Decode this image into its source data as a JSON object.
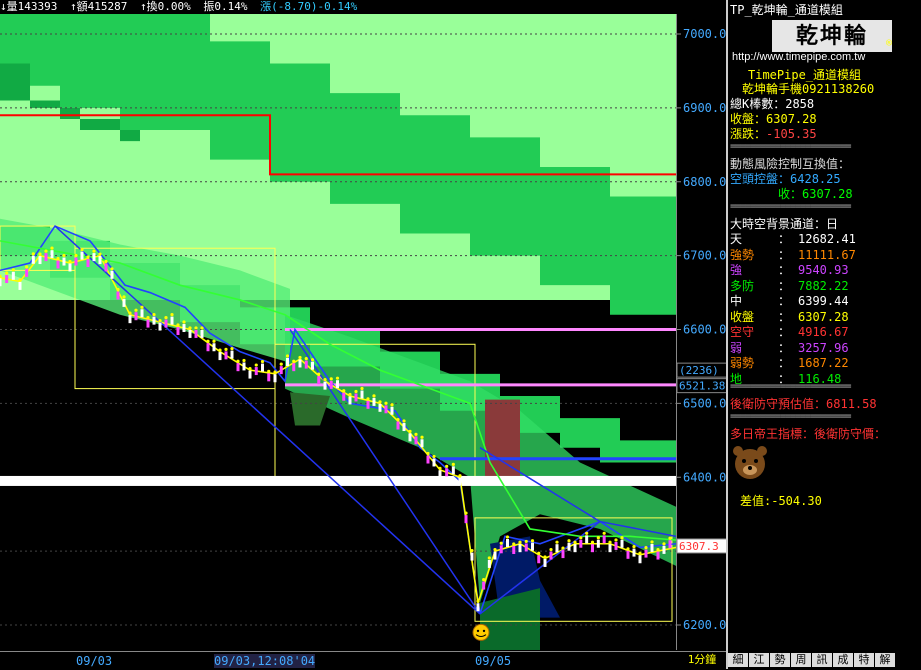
{
  "topbar": {
    "vol": "↓量143393",
    "amount": "↑額415287",
    "turnover": "↑換0.00%",
    "amp": "振0.14%",
    "change": "漲(-8.70)-0.14%"
  },
  "chart_data": {
    "type": "line",
    "title": "",
    "xlabel": "",
    "ylabel": "",
    "ylim": [
      6160,
      7030
    ],
    "y_ticks": [
      7000,
      6900,
      6800,
      6700,
      6600,
      6500,
      6400,
      6200
    ],
    "y_tick_labels": [
      "7000.0",
      "6900.0",
      "6800.0",
      "6700.0",
      "6600.0",
      "6500.0",
      "6400.0",
      "6200.0"
    ],
    "x_tick_labels": [
      "09/03",
      "09/03,12:08'04",
      "09/05",
      "1分鐘"
    ],
    "price_callouts": {
      "boxed": "(2236)",
      "level": "6521.38",
      "current": "6307.3"
    },
    "levels": {
      "red_line_1": 6890,
      "red_line_2": 6810,
      "pink_line_1": 6600,
      "pink_line_2": 6525,
      "blue_line": 6425,
      "white_band": 6395
    },
    "series": [
      {
        "color": "#ff0000",
        "values": [
          [
            0,
            6890
          ],
          [
            270,
            6890
          ],
          [
            270,
            6810
          ],
          [
            676,
            6810
          ]
        ]
      },
      {
        "color": "#ff88ff",
        "values": [
          [
            285,
            6600
          ],
          [
            676,
            6600
          ]
        ]
      },
      {
        "color": "#ff88ff",
        "values": [
          [
            285,
            6525
          ],
          [
            676,
            6525
          ]
        ]
      },
      {
        "color": "#2244ff",
        "values": [
          [
            0,
            6680
          ],
          [
            30,
            6690
          ],
          [
            55,
            6740
          ],
          [
            90,
            6720
          ],
          [
            125,
            6660
          ],
          [
            150,
            6650
          ],
          [
            185,
            6630
          ],
          [
            210,
            6595
          ],
          [
            240,
            6570
          ],
          [
            270,
            6555
          ],
          [
            285,
            6530
          ],
          [
            295,
            6600
          ],
          [
            330,
            6530
          ],
          [
            350,
            6500
          ],
          [
            395,
            6490
          ],
          [
            420,
            6440
          ],
          [
            440,
            6420
          ],
          [
            460,
            6395
          ],
          [
            480,
            6215
          ],
          [
            505,
            6320
          ],
          [
            540,
            6310
          ],
          [
            560,
            6320
          ],
          [
            600,
            6340
          ],
          [
            640,
            6305
          ],
          [
            676,
            6310
          ]
        ]
      },
      {
        "color": "#ffff00",
        "values": [
          [
            0,
            6670
          ],
          [
            20,
            6665
          ],
          [
            40,
            6700
          ],
          [
            70,
            6690
          ],
          [
            100,
            6700
          ],
          [
            130,
            6620
          ],
          [
            160,
            6610
          ],
          [
            190,
            6600
          ],
          [
            220,
            6570
          ],
          [
            250,
            6545
          ],
          [
            275,
            6540
          ],
          [
            300,
            6560
          ],
          [
            325,
            6530
          ],
          [
            350,
            6510
          ],
          [
            380,
            6500
          ],
          [
            410,
            6460
          ],
          [
            440,
            6410
          ],
          [
            460,
            6400
          ],
          [
            478,
            6230
          ],
          [
            495,
            6300
          ],
          [
            520,
            6310
          ],
          [
            545,
            6290
          ],
          [
            575,
            6310
          ],
          [
            610,
            6310
          ],
          [
            640,
            6295
          ],
          [
            676,
            6305
          ]
        ]
      },
      {
        "color": "#33ff33",
        "values": [
          [
            0,
            6720
          ],
          [
            60,
            6705
          ],
          [
            120,
            6690
          ],
          [
            180,
            6660
          ],
          [
            240,
            6640
          ],
          [
            285,
            6620
          ],
          [
            330,
            6580
          ],
          [
            380,
            6545
          ],
          [
            430,
            6520
          ],
          [
            470,
            6500
          ],
          [
            490,
            6420
          ],
          [
            530,
            6330
          ],
          [
            580,
            6320
          ],
          [
            630,
            6320
          ],
          [
            676,
            6315
          ]
        ]
      }
    ]
  },
  "panel": {
    "header": "TP_乾坤輪_通道模組",
    "logo": "乾坤輪",
    "registered": "®",
    "url": "http://www.timepipe.com.tw",
    "line1": "TimePipe_通道模組",
    "line2": "乾坤輪手機0921138260",
    "total_label": "總K棒數：",
    "total_value": "2858",
    "close_label": "收盤：",
    "close_value": "6307.28",
    "chg_label": "漲跌：",
    "chg_value": "-105.35",
    "sep1": "========================",
    "risk_title": "動態風險控制互換值：",
    "short_label": "空頭控盤：",
    "short_value": "6428.25",
    "risk_close_label": "收：",
    "risk_close_value": "6307.28",
    "sep2": "========================",
    "channel_title": "大時空背景通道：日",
    "rows": [
      {
        "label": "天",
        "value": "12682.41",
        "color": "#ffffff"
      },
      {
        "label": "強勢",
        "value": "11111.67",
        "color": "#ff8800"
      },
      {
        "label": "強",
        "value": "9540.93",
        "color": "#cc44ff"
      },
      {
        "label": "多防",
        "value": "7882.22",
        "color": "#00ee00"
      },
      {
        "label": "中",
        "value": "6399.44",
        "color": "#ffffff"
      },
      {
        "label": "收盤",
        "value": "6307.28",
        "color": "#ffff00"
      },
      {
        "label": "空守",
        "value": "4916.67",
        "color": "#ff3333"
      },
      {
        "label": "弱",
        "value": "3257.96",
        "color": "#cc44ff"
      },
      {
        "label": "弱勢",
        "value": "1687.22",
        "color": "#ff8800"
      },
      {
        "label": "地",
        "value": "116.48",
        "color": "#00ee00"
      }
    ],
    "sep3": "========================",
    "defense_label": "後衛防守預估值：",
    "defense_value": "6811.58",
    "sep4": "========================",
    "emperor": "多日帝王指標：後衛防守價：",
    "diff_label": "差值:",
    "diff_value": "-504.30"
  },
  "bottom_buttons": [
    "細",
    "江",
    "勢",
    "周",
    "訊",
    "成",
    "特",
    "解"
  ]
}
